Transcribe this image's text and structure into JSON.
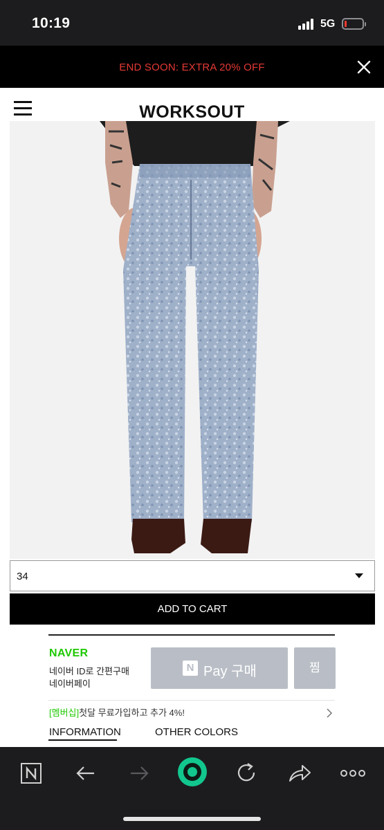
{
  "status_bar": {
    "time": "10:19",
    "network": "5G"
  },
  "promo": {
    "text": "END SOON: EXTRA 20% OFF"
  },
  "header": {
    "logo": "WORKSOUT"
  },
  "product": {
    "size_selected": "34",
    "add_to_cart_label": "ADD TO CART"
  },
  "naver_pay": {
    "brand": "NAVER",
    "desc_line1": "네이버 ID로 간편구매",
    "desc_line2": "네이버페이",
    "pay_badge": "N",
    "pay_button": "Pay 구매",
    "wish_button": "찜",
    "member_tag": "[멤버십]",
    "member_text": "첫달 무료가입하고 추가 4%!"
  },
  "tabs": [
    {
      "label": "INFORMATION",
      "active": true
    },
    {
      "label": "OTHER COLORS",
      "active": false
    }
  ],
  "toolbar": {
    "items": [
      "naver-home-icon",
      "back-arrow-icon",
      "forward-arrow-icon",
      "green-dot-icon",
      "reload-icon",
      "share-icon",
      "more-icon"
    ]
  },
  "colors": {
    "promo_text": "#e53935",
    "naver_green": "#1ec800",
    "npay_gray": "#b9bec6",
    "toolbar_bg": "#1c1c1e"
  }
}
